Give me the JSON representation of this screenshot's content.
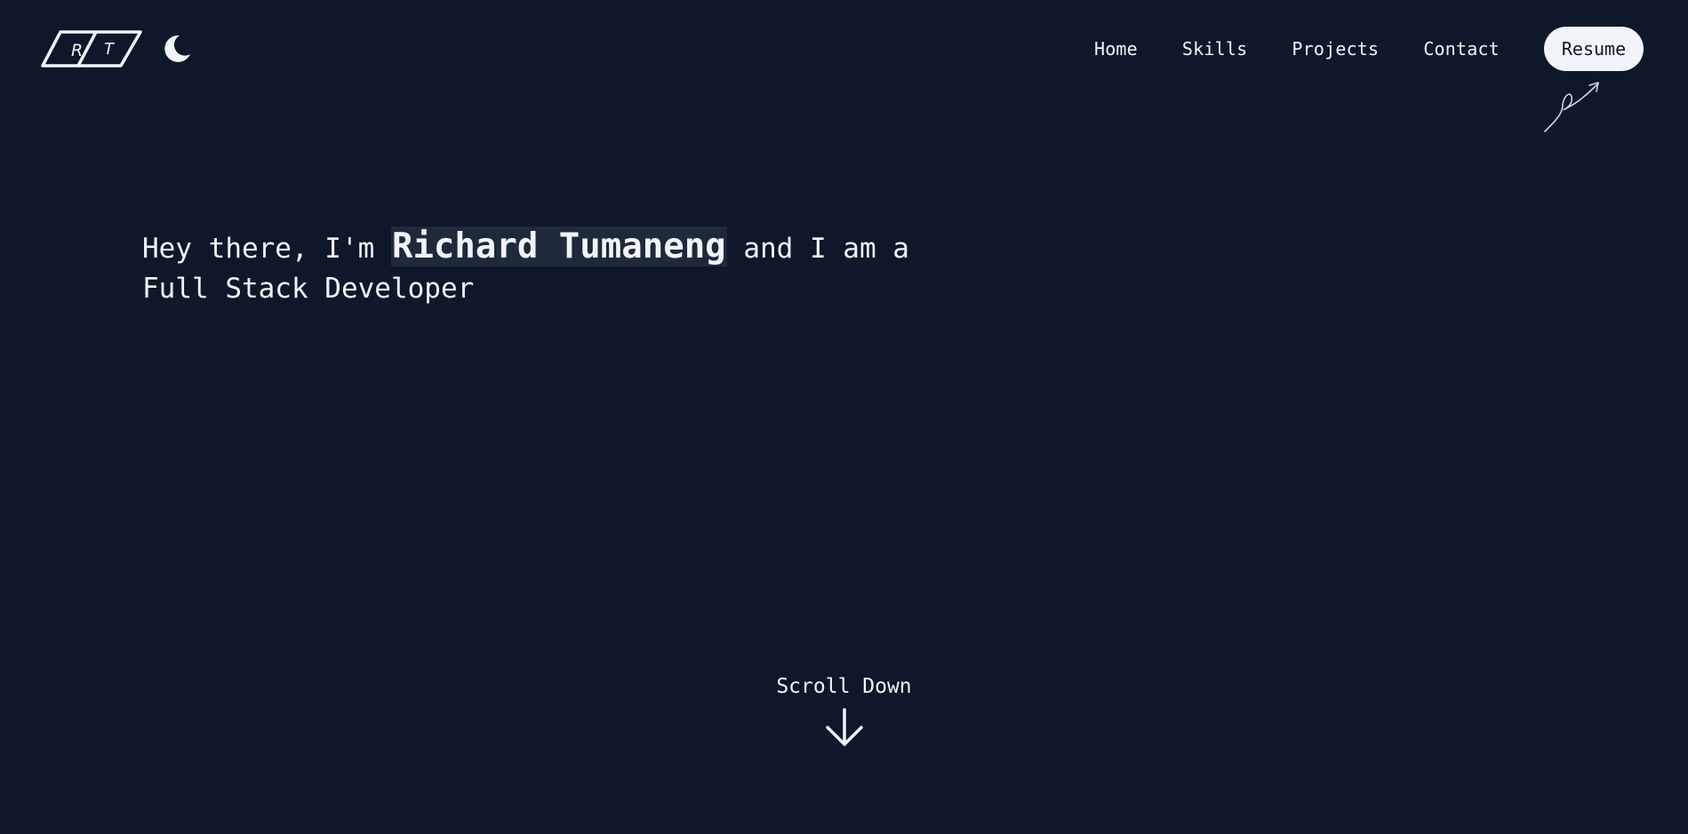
{
  "logo": {
    "letter_1": "R",
    "letter_2": "T"
  },
  "theme_toggle": {
    "icon": "moon-icon"
  },
  "nav": {
    "items": [
      {
        "label": "Home"
      },
      {
        "label": "Skills"
      },
      {
        "label": "Projects"
      },
      {
        "label": "Contact"
      }
    ],
    "resume_label": "Resume"
  },
  "hero": {
    "intro": "Hey there, I'm ",
    "name": "Richard Tumaneng",
    "after_name": " and I am a",
    "role": "Full Stack Developer"
  },
  "scroll": {
    "label": "Scroll Down",
    "icon": "arrow-down-icon"
  },
  "colors": {
    "background": "#0f172a",
    "text": "#f1f5f9",
    "name_highlight": "#1e293b",
    "button_bg": "#f1f5f9"
  }
}
